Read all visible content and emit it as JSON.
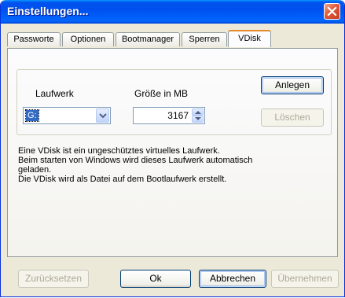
{
  "window": {
    "title": "Einstellungen..."
  },
  "tabs": [
    "Passworte",
    "Optionen",
    "Bootmanager",
    "Sperren",
    "VDisk"
  ],
  "vdisk": {
    "drive_label": "Laufwerk",
    "drive_value": "G:",
    "size_label": "Größe in MB",
    "size_value": "3167",
    "create_button": "Anlegen",
    "delete_button": "Löschen",
    "info_lines": [
      "Eine VDisk ist ein ungeschütztes virtuelles Laufwerk.",
      "Beim starten von Windows wird dieses Laufwerk automatisch",
      "geladen.",
      "Die VDisk wird als Datei auf dem Bootlaufwerk erstellt."
    ]
  },
  "footer": {
    "reset_button": "Zurücksetzen",
    "ok_button": "Ok",
    "cancel_button": "Abbrechen",
    "apply_button": "Übernehmen"
  },
  "colors": {
    "titlebar": "#0054e3",
    "dialog": "#ece9d8",
    "active_tab_accent": "#e68b2c",
    "selection": "#316ac5"
  }
}
